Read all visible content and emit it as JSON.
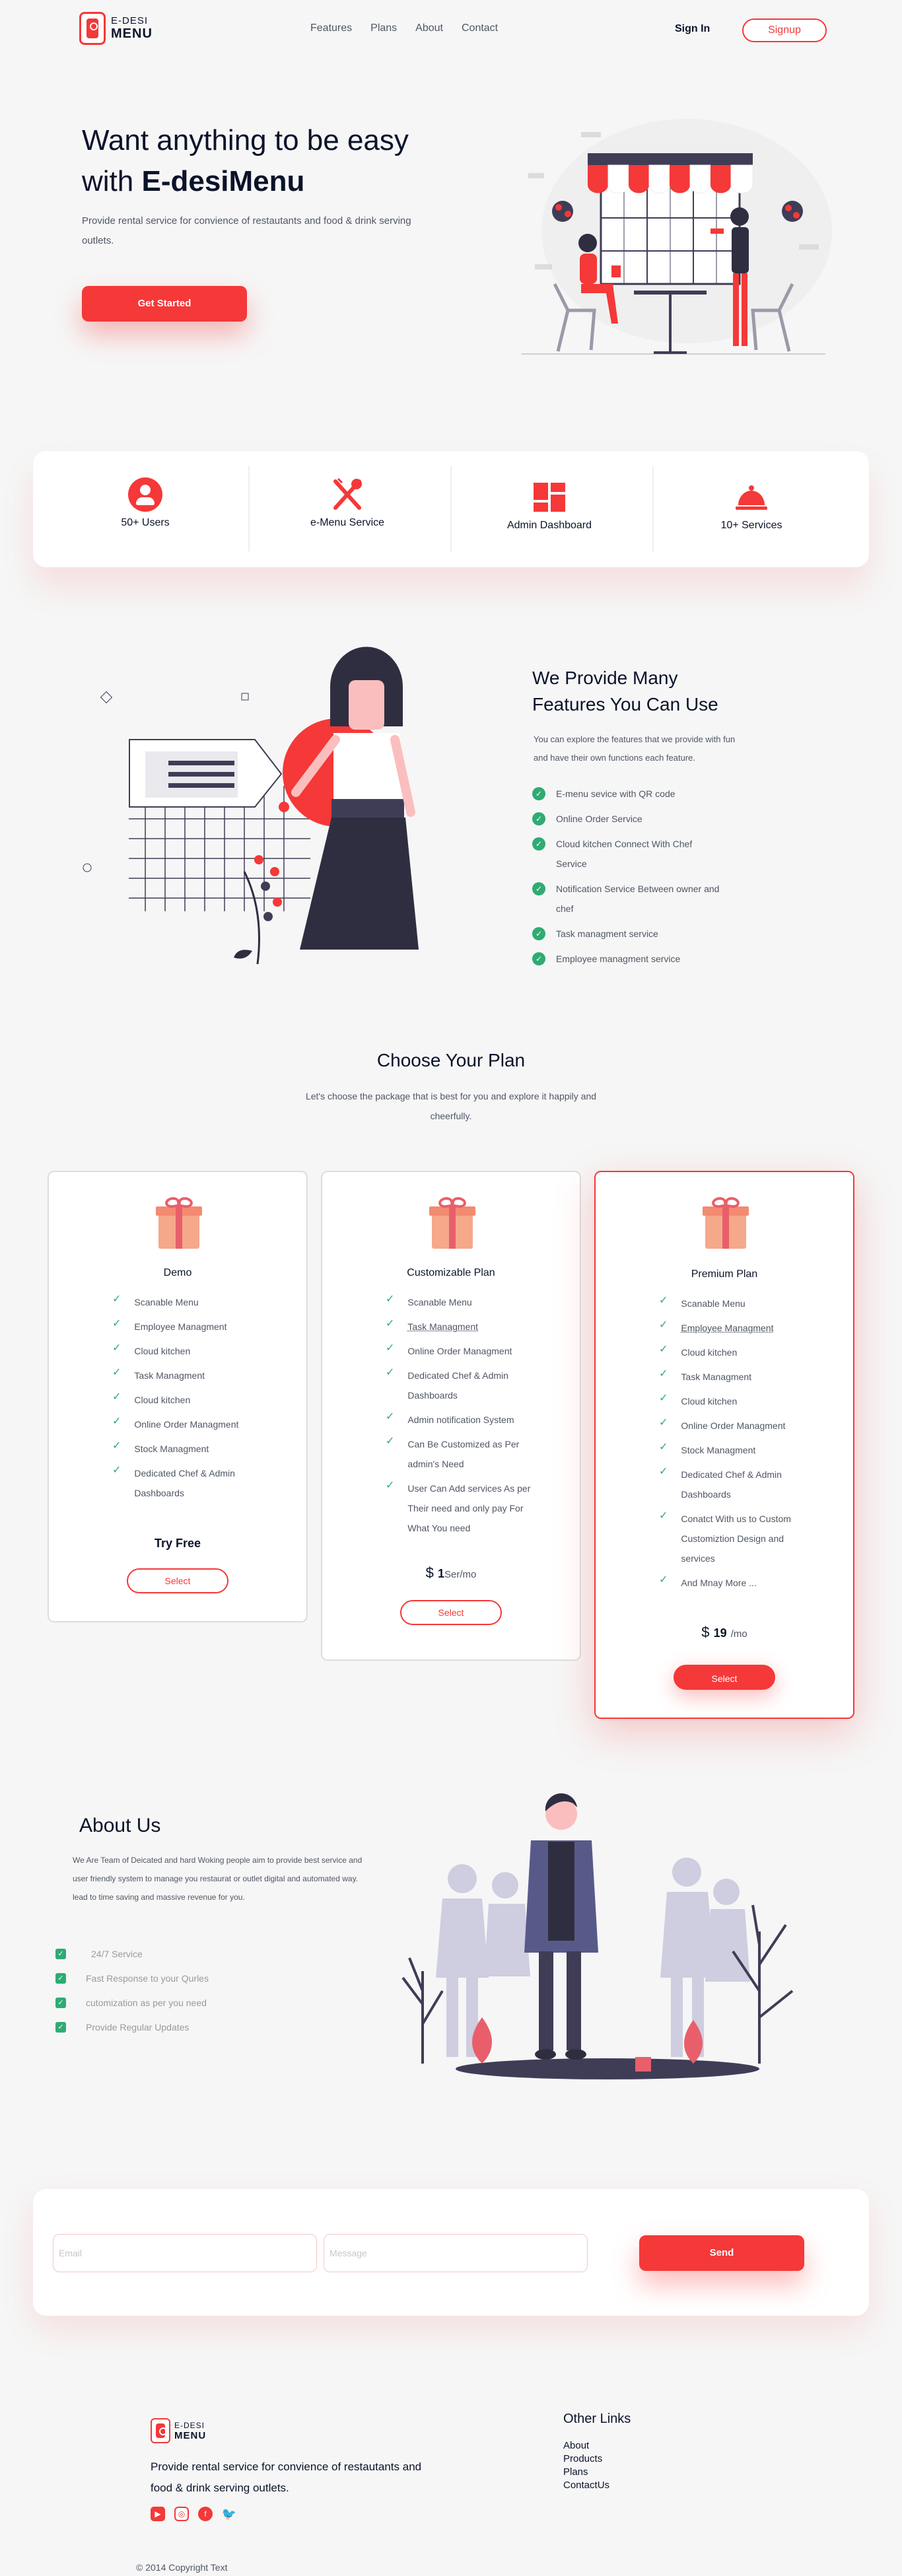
{
  "brand": {
    "line1": "E-DESI",
    "line2": "MENU"
  },
  "nav": {
    "links": [
      "Features",
      "Plans",
      "About",
      "Contact"
    ],
    "signin": "Sign In",
    "signup": "Signup"
  },
  "hero": {
    "title_plain": "Want anything to be easy",
    "title_prefix": "with ",
    "title_bold": "E-desiMenu",
    "subtitle": "Provide rental service for convience of restautants and food & drink serving outlets.",
    "cta": "Get Started"
  },
  "stats": [
    {
      "label": "50+ Users",
      "icon": "user-icon"
    },
    {
      "label": "e-Menu Service",
      "icon": "fork-spoon-icon"
    },
    {
      "label": "Admin Dashboard",
      "icon": "dashboard-icon"
    },
    {
      "label": "10+ Services",
      "icon": "cloche-icon"
    }
  ],
  "features": {
    "title_line1": "We Provide Many",
    "title_line2": "Features You Can Use",
    "desc": "You can explore the features that we provide with fun and have their own functions each feature.",
    "items": [
      "E-menu sevice with QR code",
      "Online Order Service",
      "Cloud kitchen Connect With Chef Service",
      "Notification Service Between owner and chef",
      "Task managment service",
      "Employee managment service"
    ]
  },
  "plans": {
    "title": "Choose Your Plan",
    "subtitle": "Let's choose the package that is best for you and explore it happily and cheerfully.",
    "cards": [
      {
        "name": "Demo",
        "items": [
          "Scanable Menu",
          "Employee Managment",
          "Cloud kitchen",
          "Task Managment",
          "Cloud kitchen",
          "Online Order Managment",
          "Stock Managment",
          "Dedicated Chef & Admin Dashboards"
        ],
        "price_label": "Try Free",
        "button": "Select"
      },
      {
        "name": "Customizable Plan",
        "items": [
          "Scanable Menu",
          "Task Managment",
          "Online Order Managment",
          "Dedicated Chef & Admin Dashboards",
          "Admin notification System",
          "Can Be Customized as Per admin's Need",
          "User Can Add services As per Their need and only pay For What You need"
        ],
        "price_currency": "$",
        "price_value": "1",
        "price_unit": "Ser",
        "price_period": "/mo",
        "button": "Select"
      },
      {
        "name": "Premium Plan",
        "items": [
          "Scanable Menu",
          "Employee Managment",
          "Cloud kitchen",
          "Task Managment",
          "Cloud kitchen",
          "Online Order Managment",
          "Stock Managment",
          "Dedicated Chef & Admin Dashboards",
          "Conatct With us to Custom Customiztion Design and services",
          "And Mnay More ..."
        ],
        "price_currency": "$",
        "price_value": "19",
        "price_period": "/mo",
        "button": "Select"
      }
    ]
  },
  "about": {
    "title": "About Us",
    "desc": "We Are Team of Deicated and hard Woking people aim to provide best service and user friendly system to manage you restaurat or outlet digital and automated way. lead to time saving and massive revenue for you.",
    "items": [
      "24/7 Service",
      "Fast Response to your Qurles",
      "cutomization as per you need",
      "Provide Regular Updates"
    ]
  },
  "contact": {
    "email_placeholder": "Email",
    "message_placeholder": "Message",
    "send": "Send"
  },
  "footer": {
    "desc": "Provide rental service for convience of restautants and food & drink serving outlets.",
    "links_title": "Other Links",
    "links": [
      "About",
      "Products",
      "Plans",
      "ContactUs"
    ],
    "copyright": "© 2014 Copyright Text"
  },
  "colors": {
    "accent": "#f53838",
    "check": "#2fab73",
    "text": "#0b132a",
    "muted": "#4f5665"
  }
}
